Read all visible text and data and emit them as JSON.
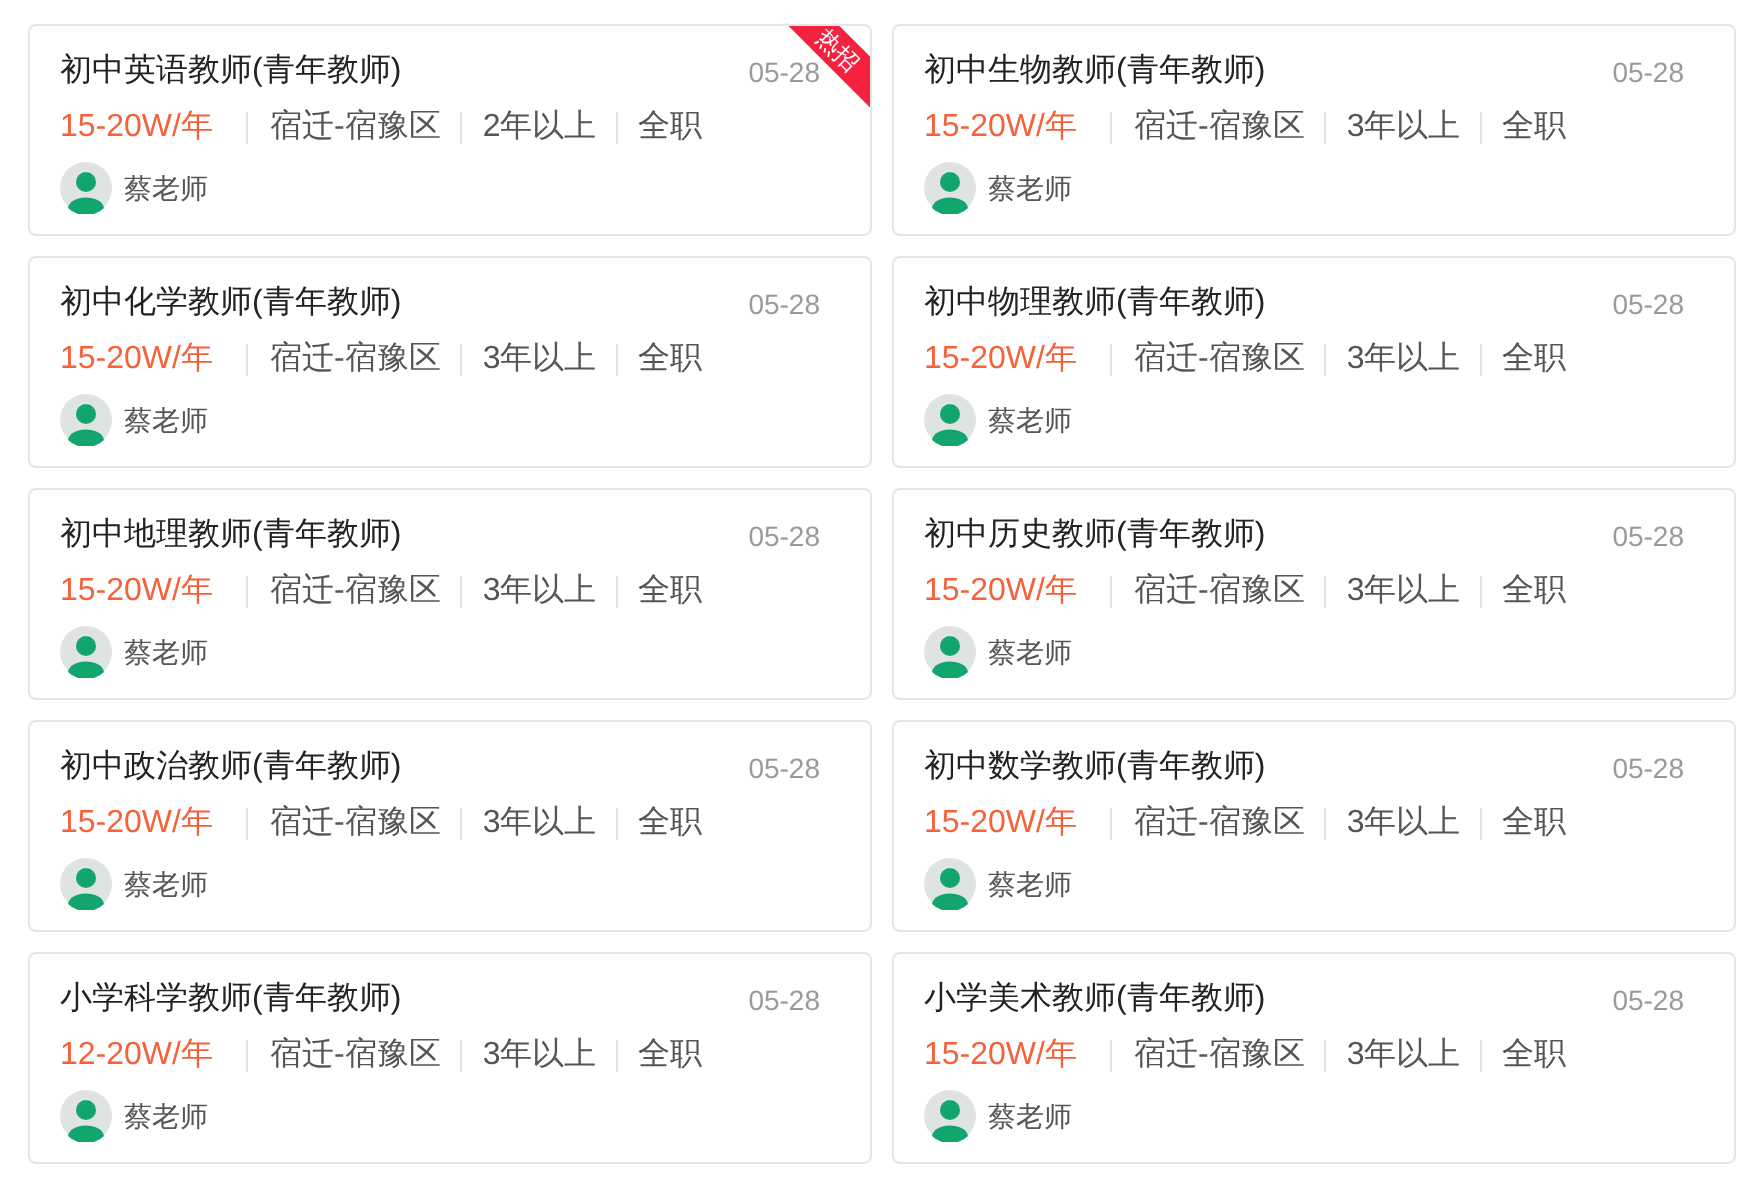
{
  "jobs": [
    {
      "title": "初中英语教师(青年教师)",
      "date": "05-28",
      "salary": "15-20W/年",
      "location": "宿迁-宿豫区",
      "experience": "2年以上",
      "type": "全职",
      "contact": "蔡老师",
      "badge": "热招"
    },
    {
      "title": "初中生物教师(青年教师)",
      "date": "05-28",
      "salary": "15-20W/年",
      "location": "宿迁-宿豫区",
      "experience": "3年以上",
      "type": "全职",
      "contact": "蔡老师"
    },
    {
      "title": "初中化学教师(青年教师)",
      "date": "05-28",
      "salary": "15-20W/年",
      "location": "宿迁-宿豫区",
      "experience": "3年以上",
      "type": "全职",
      "contact": "蔡老师"
    },
    {
      "title": "初中物理教师(青年教师)",
      "date": "05-28",
      "salary": "15-20W/年",
      "location": "宿迁-宿豫区",
      "experience": "3年以上",
      "type": "全职",
      "contact": "蔡老师"
    },
    {
      "title": "初中地理教师(青年教师)",
      "date": "05-28",
      "salary": "15-20W/年",
      "location": "宿迁-宿豫区",
      "experience": "3年以上",
      "type": "全职",
      "contact": "蔡老师"
    },
    {
      "title": "初中历史教师(青年教师)",
      "date": "05-28",
      "salary": "15-20W/年",
      "location": "宿迁-宿豫区",
      "experience": "3年以上",
      "type": "全职",
      "contact": "蔡老师"
    },
    {
      "title": "初中政治教师(青年教师)",
      "date": "05-28",
      "salary": "15-20W/年",
      "location": "宿迁-宿豫区",
      "experience": "3年以上",
      "type": "全职",
      "contact": "蔡老师"
    },
    {
      "title": "初中数学教师(青年教师)",
      "date": "05-28",
      "salary": "15-20W/年",
      "location": "宿迁-宿豫区",
      "experience": "3年以上",
      "type": "全职",
      "contact": "蔡老师"
    },
    {
      "title": "小学科学教师(青年教师)",
      "date": "05-28",
      "salary": "12-20W/年",
      "location": "宿迁-宿豫区",
      "experience": "3年以上",
      "type": "全职",
      "contact": "蔡老师"
    },
    {
      "title": "小学美术教师(青年教师)",
      "date": "05-28",
      "salary": "15-20W/年",
      "location": "宿迁-宿豫区",
      "experience": "3年以上",
      "type": "全职",
      "contact": "蔡老师"
    }
  ]
}
